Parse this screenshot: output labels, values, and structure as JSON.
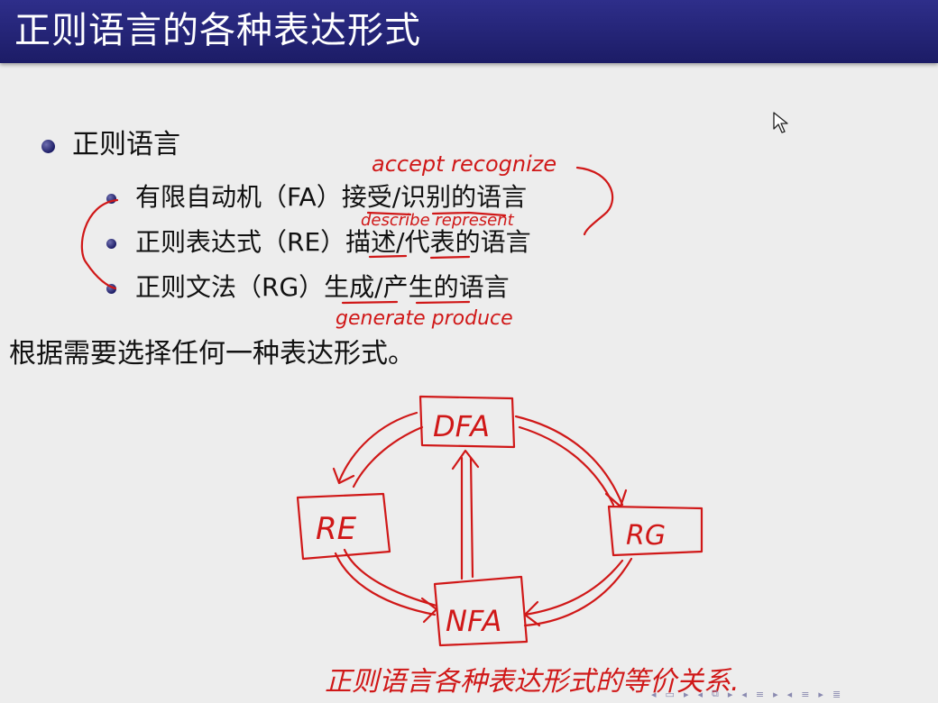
{
  "slide": {
    "title": "正则语言的各种表达形式",
    "bullet1": "正则语言",
    "sub_items": [
      "有限自动机（FA）接受/识别的语言",
      "正则表达式（RE）描述/代表的语言",
      "正则文法（RG）生成/产生的语言"
    ],
    "note": "根据需要选择任何一种表达形式。"
  },
  "annotations": {
    "above_item1": "accept recognize",
    "below_item1": "describe represent",
    "below_item3": "generate produce",
    "diagram_nodes": [
      "DFA",
      "RE",
      "RG",
      "NFA"
    ],
    "caption": "正则语言各种表达形式的等价关系."
  },
  "nav_icons": [
    "left-arrow-icon",
    "frame-icon",
    "right-arrow-icon",
    "subsection-icon",
    "section-icon",
    "align-icon"
  ],
  "colors": {
    "title_bg": "#1c1c66",
    "ink": "#d01818",
    "background": "#ededed"
  }
}
